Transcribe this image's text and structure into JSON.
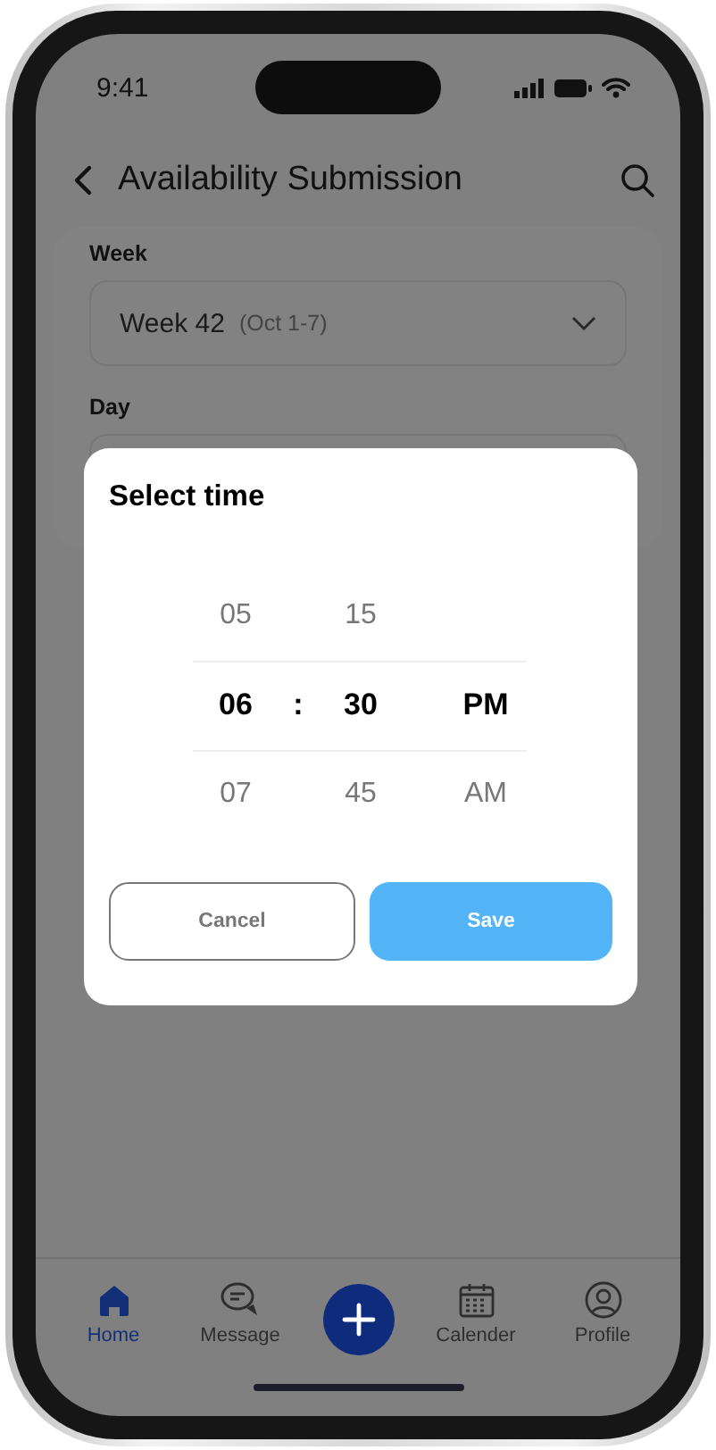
{
  "status_bar": {
    "time": "9:41"
  },
  "header": {
    "title": "Availability Submission"
  },
  "form": {
    "fields": [
      {
        "label": "Week",
        "value": "Week 42",
        "hint": "(Oct 1-7)"
      },
      {
        "label": "Day"
      }
    ]
  },
  "time_picker": {
    "title": "Select time",
    "columns": [
      {
        "kind": "wheel",
        "items": [
          {
            "label": "05",
            "selected": false
          },
          {
            "label": "06",
            "selected": true
          },
          {
            "label": "07",
            "selected": false
          }
        ]
      },
      {
        "kind": "separator",
        "label": ":"
      },
      {
        "kind": "wheel",
        "items": [
          {
            "label": "15",
            "selected": false
          },
          {
            "label": "30",
            "selected": true
          },
          {
            "label": "45",
            "selected": false
          }
        ]
      },
      {
        "kind": "wheel",
        "items": [
          {
            "label": "PM",
            "selected": true
          },
          {
            "label": "AM",
            "selected": false
          }
        ]
      }
    ],
    "buttons": [
      {
        "label": "Cancel",
        "kind": "secondary"
      },
      {
        "label": "Save",
        "kind": "primary"
      }
    ]
  },
  "nav": {
    "items": [
      {
        "kind": "home",
        "label": "Home",
        "selected": true
      },
      {
        "kind": "message",
        "label": "Message",
        "selected": false
      },
      {
        "kind": "add"
      },
      {
        "kind": "calendar",
        "label": "Calender",
        "selected": false
      },
      {
        "kind": "profile",
        "label": "Profile",
        "selected": false
      }
    ]
  }
}
